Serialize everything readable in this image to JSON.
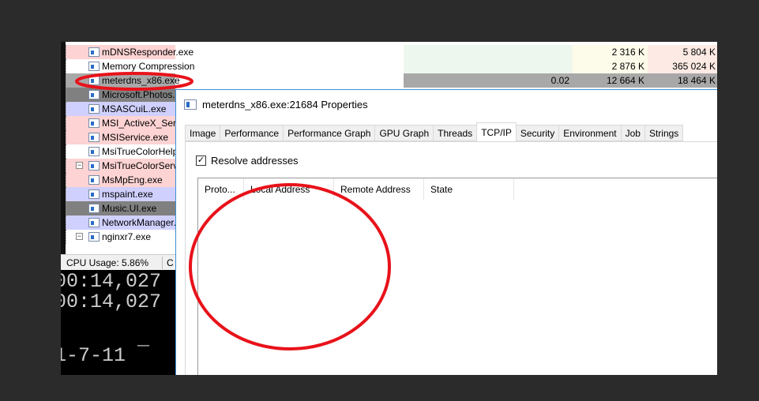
{
  "processes": [
    {
      "name": "mDNSResponder.exe",
      "bg": "#fdd3d3",
      "cpu": "",
      "private": "2 316 K",
      "working": "5 804 K",
      "icon": "app-window-icon"
    },
    {
      "name": "Memory Compression",
      "bg": "#ffffff",
      "cpu": "",
      "private": "2 876 K",
      "working": "365 024 K",
      "icon": "app-window-icon"
    },
    {
      "name": "meterdns_x86.exe",
      "bg": "#a8a8a8",
      "cpu": "0.02",
      "private": "12 664 K",
      "working": "18 464 K",
      "icon": "app-window-icon"
    },
    {
      "name": "Microsoft.Photos.exe",
      "bg": "#808080",
      "icon": "app-window-icon"
    },
    {
      "name": "MSASCuiL.exe",
      "bg": "#d0d0ff",
      "icon": "shield-icon"
    },
    {
      "name": "MSI_ActiveX_Service.exe",
      "bg": "#fdd3d3",
      "icon": "app-window-icon"
    },
    {
      "name": "MSIService.exe",
      "bg": "#fdd3d3",
      "icon": "app-window-icon"
    },
    {
      "name": "MsiTrueColorHelper.exe",
      "bg": "#ffffff",
      "icon": "app-window-icon"
    },
    {
      "name": "MsiTrueColorService.exe",
      "bg": "#fdd3d3",
      "icon": "app-window-icon",
      "expander": true
    },
    {
      "name": "MsMpEng.exe",
      "bg": "#fdd3d3",
      "icon": "app-window-icon"
    },
    {
      "name": "mspaint.exe",
      "bg": "#d0d0ff",
      "icon": "paint-palette-icon"
    },
    {
      "name": "Music.UI.exe",
      "bg": "#808080",
      "icon": "app-window-icon"
    },
    {
      "name": "NetworkManager.exe",
      "bg": "#d0d0ff",
      "icon": "network-manager-icon"
    },
    {
      "name": "nginxr7.exe",
      "bg": "#ffffff",
      "icon": "app-window-icon",
      "expander": true
    }
  ],
  "status": {
    "cpu_usage": "CPU Usage: 5.86%",
    "next": "C"
  },
  "console": {
    "lines": [
      "00:14,027",
      "00:14,027",
      "",
      "1-7-11  ¯"
    ]
  },
  "dialog": {
    "title": "meterdns_x86.exe:21684 Properties",
    "tabs": [
      "Image",
      "Performance",
      "Performance Graph",
      "GPU Graph",
      "Threads",
      "TCP/IP",
      "Security",
      "Environment",
      "Job",
      "Strings"
    ],
    "active_tab": "TCP/IP",
    "resolve_label": "Resolve addresses",
    "resolve_checked": true,
    "columns": [
      "Proto...",
      "Local Address",
      "Remote Address",
      "State"
    ]
  },
  "annotation_color": "#e8121a"
}
